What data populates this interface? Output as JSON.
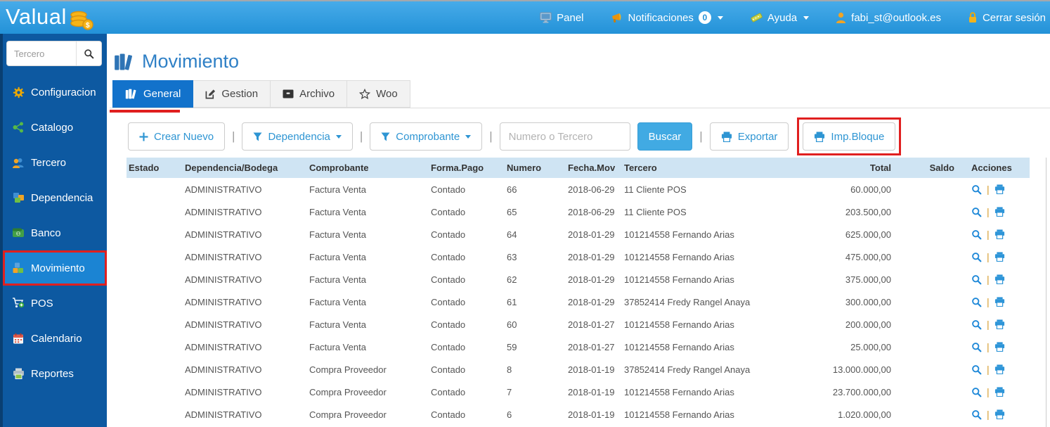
{
  "topbar": {
    "brand": "Valual",
    "panel_label": "Panel",
    "notificaciones_label": "Notificaciones",
    "notificaciones_badge": "0",
    "ayuda_label": "Ayuda",
    "user_email": "fabi_st@outlook.es",
    "logout_label": "Cerrar sesión"
  },
  "sidebar": {
    "search_placeholder": "Tercero",
    "items": [
      {
        "label": "Configuracion",
        "icon": "gear-icon",
        "active": false
      },
      {
        "label": "Catalogo",
        "icon": "share-icon",
        "active": false
      },
      {
        "label": "Tercero",
        "icon": "people-icon",
        "active": false
      },
      {
        "label": "Dependencia",
        "icon": "cubes-icon",
        "active": false
      },
      {
        "label": "Banco",
        "icon": "wallet-icon",
        "active": false
      },
      {
        "label": "Movimiento",
        "icon": "blocks-icon",
        "active": true
      },
      {
        "label": "POS",
        "icon": "cart-icon",
        "active": false
      },
      {
        "label": "Calendario",
        "icon": "calendar-icon",
        "active": false
      },
      {
        "label": "Reportes",
        "icon": "printer-icon",
        "active": false
      }
    ]
  },
  "page": {
    "title": "Movimiento",
    "tabs": [
      {
        "label": "General",
        "active": true
      },
      {
        "label": "Gestion",
        "active": false
      },
      {
        "label": "Archivo",
        "active": false
      },
      {
        "label": "Woo",
        "active": false
      }
    ]
  },
  "toolbar": {
    "crear_nuevo_label": "Crear Nuevo",
    "dependencia_label": "Dependencia",
    "comprobante_label": "Comprobante",
    "search_placeholder": "Numero o Tercero",
    "buscar_label": "Buscar",
    "exportar_label": "Exportar",
    "imp_bloque_label": "Imp.Bloque",
    "separator": "|"
  },
  "table": {
    "headers": [
      "Estado",
      "Dependencia/Bodega",
      "Comprobante",
      "Forma.Pago",
      "Numero",
      "Fecha.Mov",
      "Tercero",
      "Total",
      "Saldo",
      "Acciones"
    ],
    "action_separator": "|",
    "rows": [
      {
        "estado": "",
        "dependencia": "ADMINISTRATIVO",
        "comprobante": "Factura Venta",
        "forma_pago": "Contado",
        "numero": "66",
        "fecha_mov": "2018-06-29",
        "tercero": "11 Cliente POS",
        "total": "60.000,00",
        "saldo": ""
      },
      {
        "estado": "",
        "dependencia": "ADMINISTRATIVO",
        "comprobante": "Factura Venta",
        "forma_pago": "Contado",
        "numero": "65",
        "fecha_mov": "2018-06-29",
        "tercero": "11 Cliente POS",
        "total": "203.500,00",
        "saldo": ""
      },
      {
        "estado": "",
        "dependencia": "ADMINISTRATIVO",
        "comprobante": "Factura Venta",
        "forma_pago": "Contado",
        "numero": "64",
        "fecha_mov": "2018-01-29",
        "tercero": "101214558 Fernando Arias",
        "total": "625.000,00",
        "saldo": ""
      },
      {
        "estado": "",
        "dependencia": "ADMINISTRATIVO",
        "comprobante": "Factura Venta",
        "forma_pago": "Contado",
        "numero": "63",
        "fecha_mov": "2018-01-29",
        "tercero": "101214558 Fernando Arias",
        "total": "475.000,00",
        "saldo": ""
      },
      {
        "estado": "",
        "dependencia": "ADMINISTRATIVO",
        "comprobante": "Factura Venta",
        "forma_pago": "Contado",
        "numero": "62",
        "fecha_mov": "2018-01-29",
        "tercero": "101214558 Fernando Arias",
        "total": "375.000,00",
        "saldo": ""
      },
      {
        "estado": "",
        "dependencia": "ADMINISTRATIVO",
        "comprobante": "Factura Venta",
        "forma_pago": "Contado",
        "numero": "61",
        "fecha_mov": "2018-01-29",
        "tercero": "37852414 Fredy Rangel Anaya",
        "total": "300.000,00",
        "saldo": ""
      },
      {
        "estado": "",
        "dependencia": "ADMINISTRATIVO",
        "comprobante": "Factura Venta",
        "forma_pago": "Contado",
        "numero": "60",
        "fecha_mov": "2018-01-27",
        "tercero": "101214558 Fernando Arias",
        "total": "200.000,00",
        "saldo": ""
      },
      {
        "estado": "",
        "dependencia": "ADMINISTRATIVO",
        "comprobante": "Factura Venta",
        "forma_pago": "Contado",
        "numero": "59",
        "fecha_mov": "2018-01-27",
        "tercero": "101214558 Fernando Arias",
        "total": "25.000,00",
        "saldo": ""
      },
      {
        "estado": "",
        "dependencia": "ADMINISTRATIVO",
        "comprobante": "Compra Proveedor",
        "forma_pago": "Contado",
        "numero": "8",
        "fecha_mov": "2018-01-19",
        "tercero": "37852414 Fredy Rangel Anaya",
        "total": "13.000.000,00",
        "saldo": ""
      },
      {
        "estado": "",
        "dependencia": "ADMINISTRATIVO",
        "comprobante": "Compra Proveedor",
        "forma_pago": "Contado",
        "numero": "7",
        "fecha_mov": "2018-01-19",
        "tercero": "101214558 Fernando Arias",
        "total": "23.700.000,00",
        "saldo": ""
      },
      {
        "estado": "",
        "dependencia": "ADMINISTRATIVO",
        "comprobante": "Compra Proveedor",
        "forma_pago": "Contado",
        "numero": "6",
        "fecha_mov": "2018-01-19",
        "tercero": "101214558 Fernando Arias",
        "total": "1.020.000,00",
        "saldo": ""
      }
    ]
  },
  "colors": {
    "topbar_gradient_top": "#47abe9",
    "topbar_gradient_bottom": "#2392d8",
    "sidebar_bg": "#0d59a1",
    "sidebar_active_bg": "#1b84d3",
    "tab_active_bg": "#1272cb",
    "accent_blue": "#2e95d3",
    "buscar_bg": "#41aae3",
    "table_header_bg": "#cfe4f3",
    "action_icon_blue": "#1e88d8",
    "annotation_red": "#e01f1f"
  }
}
